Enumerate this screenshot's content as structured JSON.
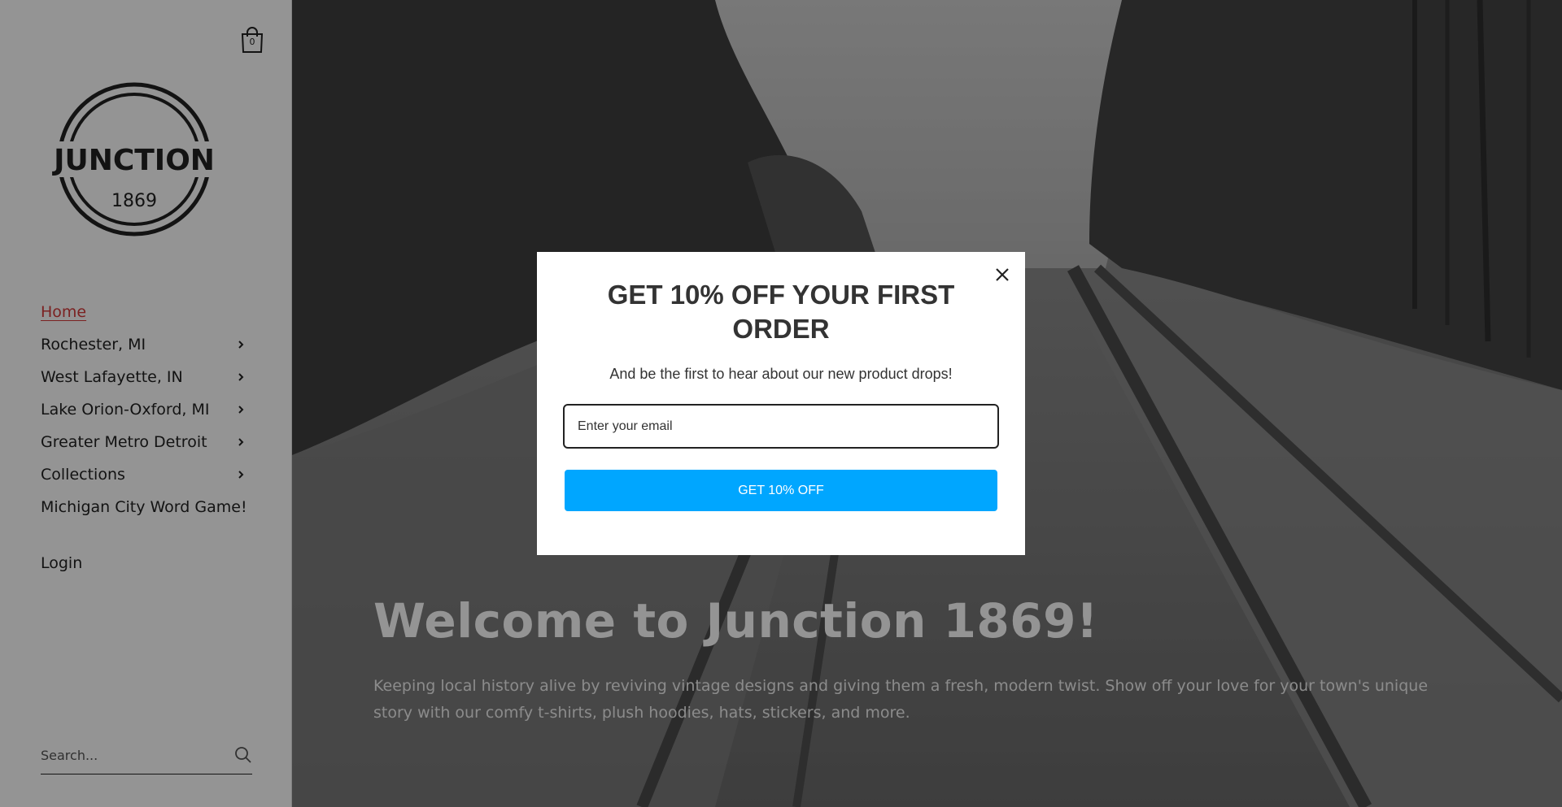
{
  "cart": {
    "count": "0",
    "icon": "shopping-bag-icon"
  },
  "logo": {
    "name": "JUNCTION",
    "year": "1869"
  },
  "nav": {
    "items": [
      {
        "label": "Home",
        "active": true,
        "has_children": false
      },
      {
        "label": "Rochester, MI",
        "active": false,
        "has_children": true
      },
      {
        "label": "West Lafayette, IN",
        "active": false,
        "has_children": true
      },
      {
        "label": "Lake Orion-Oxford, MI",
        "active": false,
        "has_children": true
      },
      {
        "label": "Greater Metro Detroit",
        "active": false,
        "has_children": true
      },
      {
        "label": "Collections",
        "active": false,
        "has_children": true
      },
      {
        "label": "Michigan City Word Game!",
        "active": false,
        "has_children": false
      }
    ],
    "login_label": "Login"
  },
  "search": {
    "placeholder": "Search...",
    "icon": "search-icon"
  },
  "hero": {
    "title": "Welcome to Junction 1869!",
    "subtitle": "Keeping local history alive by reviving vintage designs and giving them a fresh, modern twist. Show off your love for your town's unique story with our comfy t-shirts, plush hoodies, hats, stickers, and more."
  },
  "modal": {
    "title": "GET 10% OFF YOUR FIRST ORDER",
    "subtitle": "And be the first to hear about our new product drops!",
    "email_placeholder": "Enter your email",
    "button_label": "GET 10% OFF",
    "button_color": "#00a6ff"
  },
  "colors": {
    "accent_active": "#d43b3b",
    "overlay": "rgba(0,0,0,0.42)"
  }
}
